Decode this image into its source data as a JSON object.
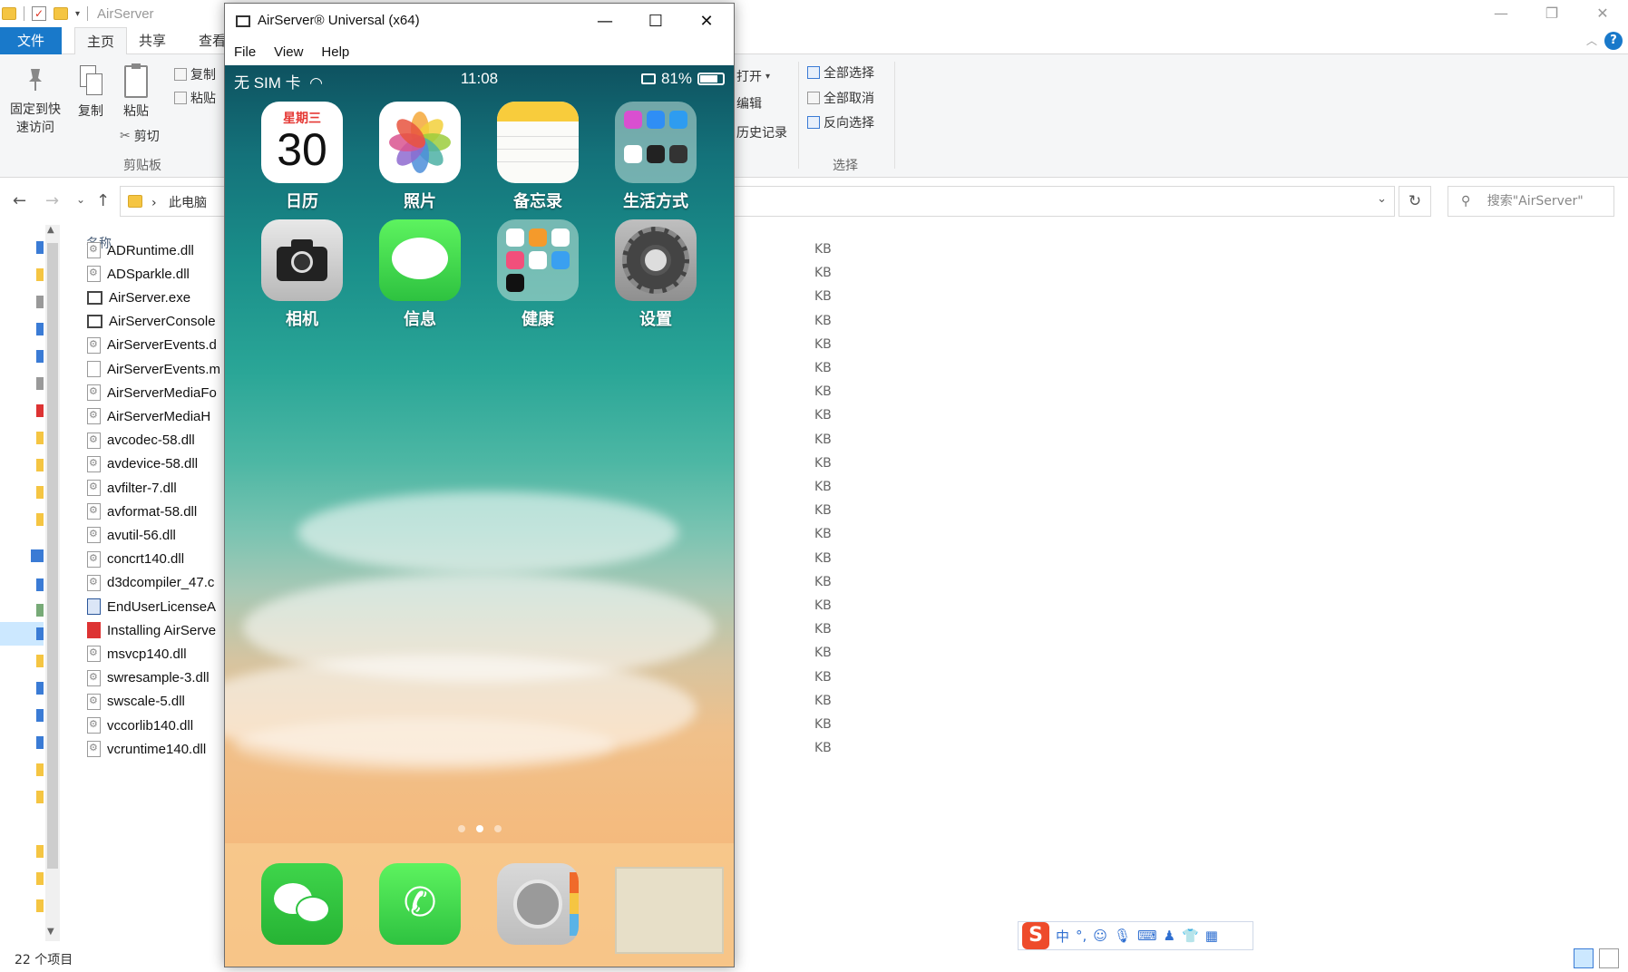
{
  "explorer": {
    "title": "AirServer",
    "ribbon_tabs": [
      "文件",
      "主页",
      "共享",
      "查看"
    ],
    "ribbon": {
      "pin_label_1": "固定到快",
      "pin_label_2": "速访问",
      "copy_label": "复制",
      "paste_label": "粘贴",
      "copy_path_label": "复制",
      "paste_shortcut_label": "粘贴",
      "cut_label": "剪切",
      "clipboard_group": "剪贴板",
      "open_label": "打开",
      "edit_label": "编辑",
      "history_label": "历史记录",
      "select_all": "全部选择",
      "select_none": "全部取消",
      "invert_select": "反向选择",
      "select_group": "选择"
    },
    "address": {
      "path": "此电脑"
    },
    "search": {
      "placeholder": "搜索\"AirServer\""
    },
    "column_name": "名称",
    "files": [
      {
        "name": "ADRuntime.dll",
        "type": "dll",
        "size": "KB"
      },
      {
        "name": "ADSparkle.dll",
        "type": "dll",
        "size": "KB"
      },
      {
        "name": "AirServer.exe",
        "type": "exe",
        "size": "KB"
      },
      {
        "name": "AirServerConsole",
        "type": "console",
        "size": "KB"
      },
      {
        "name": "AirServerEvents.d",
        "type": "dll",
        "size": "KB"
      },
      {
        "name": "AirServerEvents.m",
        "type": "blank",
        "size": "KB"
      },
      {
        "name": "AirServerMediaFo",
        "type": "dll",
        "size": "KB"
      },
      {
        "name": "AirServerMediaH",
        "type": "dll",
        "size": "KB"
      },
      {
        "name": "avcodec-58.dll",
        "type": "dll",
        "size": "KB"
      },
      {
        "name": "avdevice-58.dll",
        "type": "dll",
        "size": "KB"
      },
      {
        "name": "avfilter-7.dll",
        "type": "dll",
        "size": "KB"
      },
      {
        "name": "avformat-58.dll",
        "type": "dll",
        "size": "KB"
      },
      {
        "name": "avutil-56.dll",
        "type": "dll",
        "size": "KB"
      },
      {
        "name": "concrt140.dll",
        "type": "dll",
        "size": "KB"
      },
      {
        "name": "d3dcompiler_47.c",
        "type": "dll",
        "size": "KB"
      },
      {
        "name": "EndUserLicenseA",
        "type": "doc",
        "size": "KB"
      },
      {
        "name": "Installing AirServe",
        "type": "pdf",
        "size": "KB"
      },
      {
        "name": "msvcp140.dll",
        "type": "dll",
        "size": "KB"
      },
      {
        "name": "swresample-3.dll",
        "type": "dll",
        "size": "KB"
      },
      {
        "name": "swscale-5.dll",
        "type": "dll",
        "size": "KB"
      },
      {
        "name": "vccorlib140.dll",
        "type": "dll",
        "size": "KB"
      },
      {
        "name": "vcruntime140.dll",
        "type": "dll",
        "size": "KB"
      }
    ],
    "status": "22 个项目",
    "icons": {
      "file_dll": "dll-file-icon",
      "file_pdf": "pdf-file-icon",
      "refresh": "refresh-icon",
      "search": "search-icon"
    },
    "colors": {
      "accent": "#1979ca",
      "folder": "#f5c542"
    }
  },
  "airserver": {
    "title": "AirServer® Universal (x64)",
    "menu": [
      "File",
      "View",
      "Help"
    ],
    "phone": {
      "carrier": "无 SIM 卡",
      "time": "11:08",
      "battery": "81%",
      "battery_level": 0.81,
      "calendar_weekday": "星期三",
      "calendar_date": "30",
      "apps_row1": [
        "日历",
        "照片",
        "备忘录",
        "生活方式"
      ],
      "apps_row2": [
        "相机",
        "信息",
        "健康",
        "设置"
      ],
      "page_count": 3,
      "current_page": 2,
      "dock": [
        "wechat",
        "phone",
        "contacts",
        "blank"
      ]
    }
  },
  "ime": {
    "logo": "S",
    "mode": "中",
    "punct": "°,"
  }
}
